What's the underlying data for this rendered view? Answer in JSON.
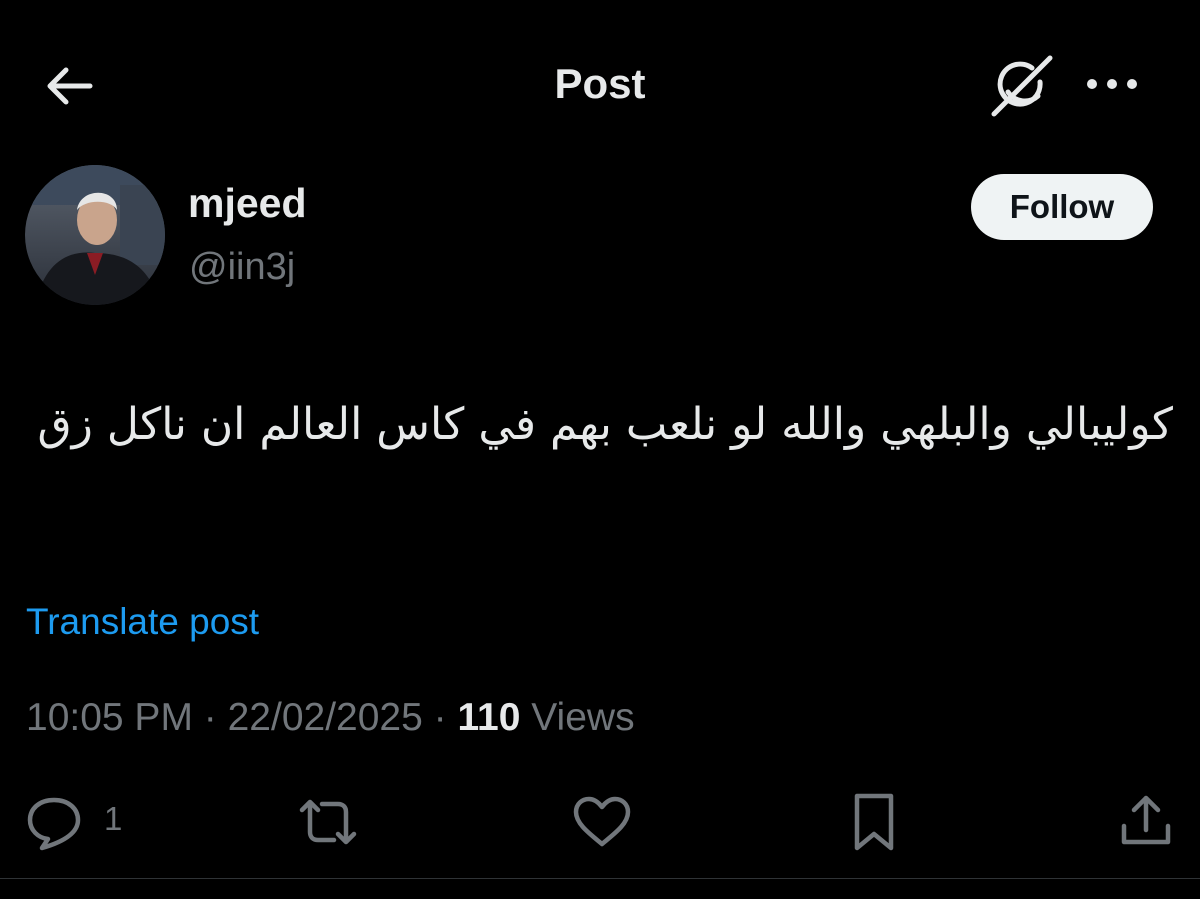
{
  "header": {
    "title": "Post",
    "back_icon": "arrow-left-icon",
    "grok_icon": "grok-icon",
    "more_icon": "more-horizontal-icon"
  },
  "author": {
    "display_name": "mjeed",
    "handle": "@iin3j",
    "follow_label": "Follow"
  },
  "post": {
    "text": "كوليبالي والبلهي والله لو نلعب بهم في كاس العالم ان ناكل زق",
    "translate_label": "Translate post",
    "time": "10:05 PM",
    "separator": " · ",
    "date": "22/02/2025",
    "views_count": "110",
    "views_label": " Views"
  },
  "actions": {
    "reply_count": "1",
    "icons": [
      "reply-icon",
      "repost-icon",
      "like-icon",
      "bookmark-icon",
      "share-icon"
    ]
  },
  "colors": {
    "background": "#000000",
    "text_primary": "#e7e9ea",
    "text_secondary": "#71767b",
    "link": "#1d9bf0",
    "follow_bg": "#eff3f4"
  }
}
